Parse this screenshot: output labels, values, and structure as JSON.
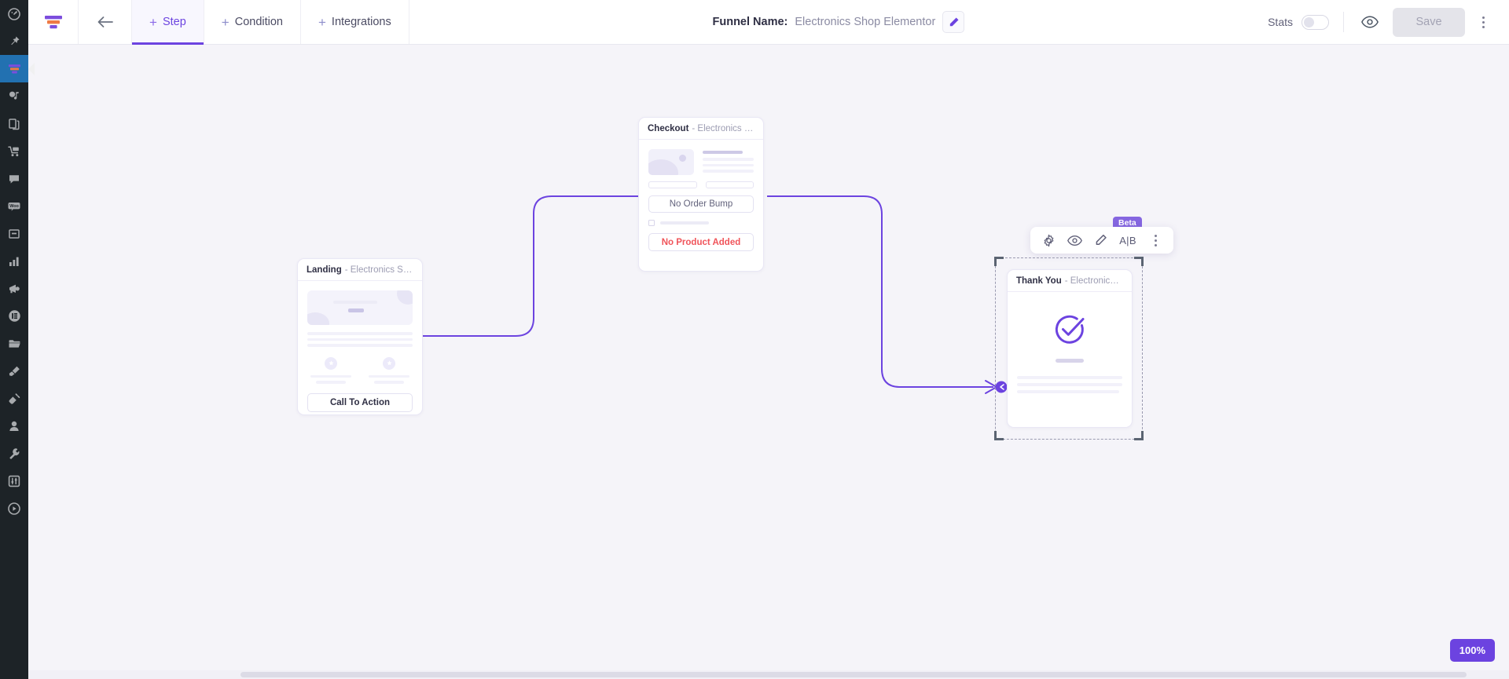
{
  "wp_sidebar": {
    "items": [
      {
        "name": "dashboard-icon",
        "icon": "gauge"
      },
      {
        "name": "pin-icon",
        "icon": "pin"
      },
      {
        "name": "cartflows-funnel-icon",
        "icon": "funnel",
        "active": true
      },
      {
        "name": "media-icon",
        "icon": "media"
      },
      {
        "name": "pages-icon",
        "icon": "pages"
      },
      {
        "name": "woocommerce-cart-icon",
        "icon": "cart"
      },
      {
        "name": "comments-icon",
        "icon": "comment"
      },
      {
        "name": "woo-icon",
        "icon": "woo"
      },
      {
        "name": "archive-icon",
        "icon": "archive"
      },
      {
        "name": "analytics-icon",
        "icon": "bars"
      },
      {
        "name": "megaphone-icon",
        "icon": "megaphone"
      },
      {
        "name": "elementor-icon",
        "icon": "elementor"
      },
      {
        "name": "folder-icon",
        "icon": "folder"
      },
      {
        "name": "appearance-brush-icon",
        "icon": "brush"
      },
      {
        "name": "plugins-icon",
        "icon": "plug"
      },
      {
        "name": "users-icon",
        "icon": "user"
      },
      {
        "name": "tools-wrench-icon",
        "icon": "wrench"
      },
      {
        "name": "settings-sliders-icon",
        "icon": "sliders"
      },
      {
        "name": "collapse-play-icon",
        "icon": "play"
      }
    ]
  },
  "topbar": {
    "logo_alt": "CartFlows funnel logo",
    "back_label": "Back",
    "tabs": [
      {
        "label": "Step",
        "active": true
      },
      {
        "label": "Condition",
        "active": false
      },
      {
        "label": "Integrations",
        "active": false
      }
    ],
    "funnel_name_label": "Funnel Name:",
    "funnel_name_value": "Electronics Shop Elementor",
    "edit_name_title": "Edit funnel name",
    "stats_label": "Stats",
    "stats_enabled": false,
    "preview_title": "Preview",
    "save_label": "Save",
    "save_disabled": true,
    "more_menu_title": "More options"
  },
  "canvas": {
    "zoom_level": "100%",
    "accent_color": "#6c43e0",
    "edge_color": "#6c43e0",
    "background_color": "#f5f4f9",
    "nodes": [
      {
        "id": "landing",
        "name": "Landing",
        "subtitle": "- Electronics Sh...",
        "cta_label": "Call To Action",
        "selected": false
      },
      {
        "id": "checkout",
        "name": "Checkout",
        "subtitle": "- Electronics Sh...",
        "order_bump_label": "No Order Bump",
        "product_label": "No Product Added",
        "product_label_color": "#f0545a",
        "selected": false
      },
      {
        "id": "thankyou",
        "name": "Thank You",
        "subtitle": "- Electronics Sh...",
        "selected": true
      }
    ],
    "node_toolbar": {
      "badge": "Beta",
      "buttons": [
        {
          "name": "settings-gear-icon",
          "label": "",
          "icon": "gear"
        },
        {
          "name": "preview-eye-icon",
          "label": "",
          "icon": "eye"
        },
        {
          "name": "edit-pencil-icon",
          "label": "",
          "icon": "pencil"
        },
        {
          "name": "ab-test-button",
          "label": "A|B",
          "icon": "ab"
        },
        {
          "name": "node-more-menu",
          "label": "",
          "icon": "dots"
        }
      ]
    }
  }
}
